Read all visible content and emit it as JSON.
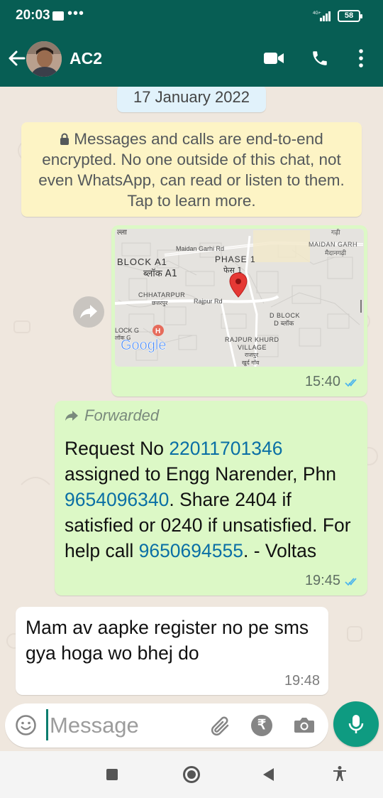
{
  "status_bar": {
    "time": "20:03",
    "network_label": "4G+",
    "battery": "58"
  },
  "header": {
    "contact_name": "AC2",
    "theme_color": "#075e54"
  },
  "chat": {
    "date_chip": "17 January 2022",
    "encryption_notice": "Messages and calls are end-to-end encrypted. No one outside of this chat, not even WhatsApp, can read or listen to them. Tap to learn more.",
    "location_message": {
      "time": "15:40",
      "status": "read",
      "map_labels": {
        "top_left": "ल्ला",
        "top_right": "गढ़ी",
        "maidan_garhi_rd": "Maidan Garhi Rd",
        "maidan_garh": "MAIDAN GARH",
        "maidan_garh_hi": "मैदानगढ़ी",
        "block_a1": "BLOCK A1",
        "block_a1_hi": "ब्लॉक A1",
        "phase_1": "PHASE 1",
        "phase_1_hi": "फेस 1",
        "chhatarpur": "CHHATARPUR",
        "chhatarpur_hi": "छत्तरपुर",
        "rajpur_rd": "Rajpur Rd",
        "d_block": "D BLOCK",
        "d_block_hi": "D ब्लॉक",
        "lock_g": "LOCK G",
        "lock_g_hi": "लॉक G",
        "rajpur_khurd": "RAJPUR KHURD",
        "village": "VILLAGE",
        "rajpur_hi": "राजपुर",
        "khurd_gaon_hi": "खुर्द गाँव",
        "google": "Google"
      }
    },
    "forwarded_message": {
      "forwarded_label": "Forwarded",
      "text_1": "Request No ",
      "request_no": "22011701346",
      "text_2": " assigned to Engg Narender, Phn ",
      "phone_1": "9654096340",
      "text_3": ". Share 2404 if satisfied or 0240 if unsatisfied. For help call ",
      "phone_2": "9650694555",
      "text_4": ". - Voltas",
      "time": "19:45",
      "status": "read"
    },
    "incoming_message": {
      "text": "Mam av aapke register no pe sms gya hoga wo bhej do",
      "time": "19:48"
    }
  },
  "composer": {
    "placeholder": "Message",
    "rupee_symbol": "₹"
  },
  "colors": {
    "outgoing_bubble": "#dcf8c6",
    "incoming_bubble": "#ffffff",
    "chat_background": "#efe7de",
    "link": "#0a6fa5",
    "read_ticks": "#4fb6ec",
    "mic_button": "#0e9b81"
  }
}
